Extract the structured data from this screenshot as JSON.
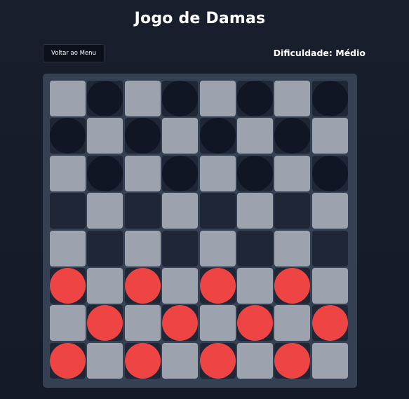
{
  "header": {
    "title": "Jogo de Damas",
    "back_label": "Voltar ao Menu",
    "difficulty_label": "Dificuldade: Médio"
  },
  "colors": {
    "light_square": "#9ca3af",
    "dark_square": "#1f2736",
    "board_frame": "#354053",
    "black_piece": "#101623",
    "red_piece": "#ef4444"
  },
  "board": {
    "size": 8,
    "rows": [
      ".b.b.b.b",
      "b.b.b.b.",
      ".b.b.b.b",
      "........",
      "........",
      "r.r.r.r.",
      ".r.r.r.r",
      "r.r.r.r."
    ]
  }
}
